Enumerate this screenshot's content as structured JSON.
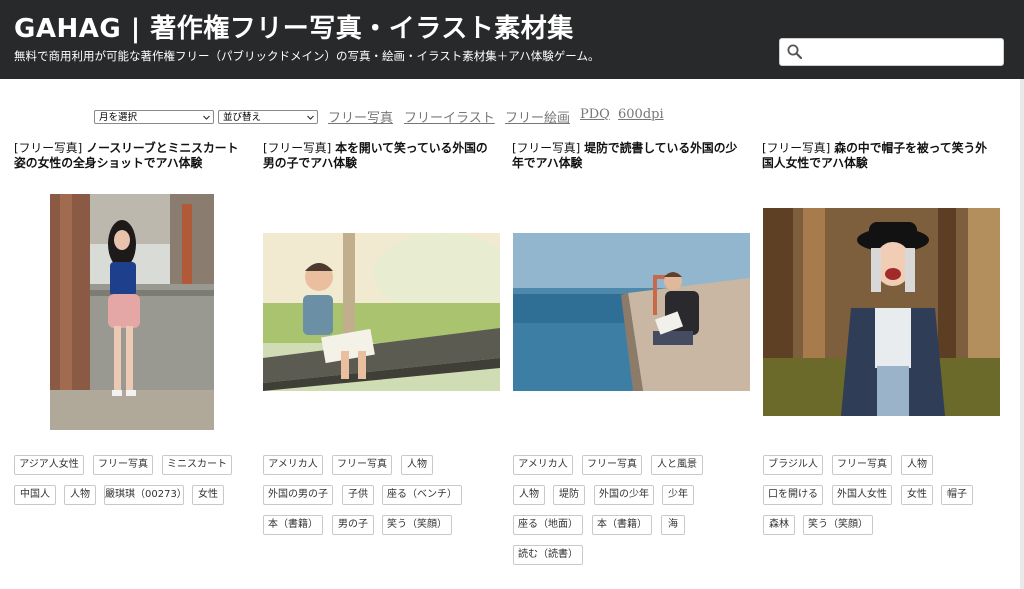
{
  "header": {
    "site_title": "GAHAG | 著作権フリー写真・イラスト素材集",
    "tagline": "無料で商用利用が可能な著作権フリー（パブリックドメイン）の写真・絵画・イラスト素材集＋アハ体験ゲーム。",
    "search_placeholder": ""
  },
  "filters": {
    "month_select": "月を選択",
    "sort_select": "並び替え"
  },
  "nav_links": [
    "フリー写真",
    "フリーイラスト",
    "フリー絵画",
    "PDQ",
    "600dpi"
  ],
  "cards": [
    {
      "category": "[フリー写真]",
      "title": " ノースリーブとミニスカート姿の女性の全身ショットでアハ体験",
      "tags": [
        "アジア人女性",
        "フリー写真",
        "ミニスカート",
        "中国人",
        "人物",
        "嚴琪琪（00273）",
        "女性"
      ]
    },
    {
      "category": "[フリー写真]",
      "title": " 本を開いて笑っている外国の男の子でアハ体験",
      "tags": [
        "アメリカ人",
        "フリー写真",
        "人物",
        "外国の男の子",
        "子供",
        "座る（ベンチ）",
        "本（書籍）",
        "男の子",
        "笑う（笑顔）"
      ]
    },
    {
      "category": "[フリー写真]",
      "title": " 堤防で読書している外国の少年でアハ体験",
      "tags": [
        "アメリカ人",
        "フリー写真",
        "人と風景",
        "人物",
        "堤防",
        "外国の少年",
        "少年",
        "座る（地面）",
        "本（書籍）",
        "海",
        "読む（読書）"
      ]
    },
    {
      "category": "[フリー写真]",
      "title": " 森の中で帽子を被って笑う外国人女性でアハ体験",
      "tags": [
        "ブラジル人",
        "フリー写真",
        "人物",
        "口を開ける",
        "外国人女性",
        "女性",
        "帽子",
        "森林",
        "笑う（笑顔）"
      ]
    }
  ]
}
